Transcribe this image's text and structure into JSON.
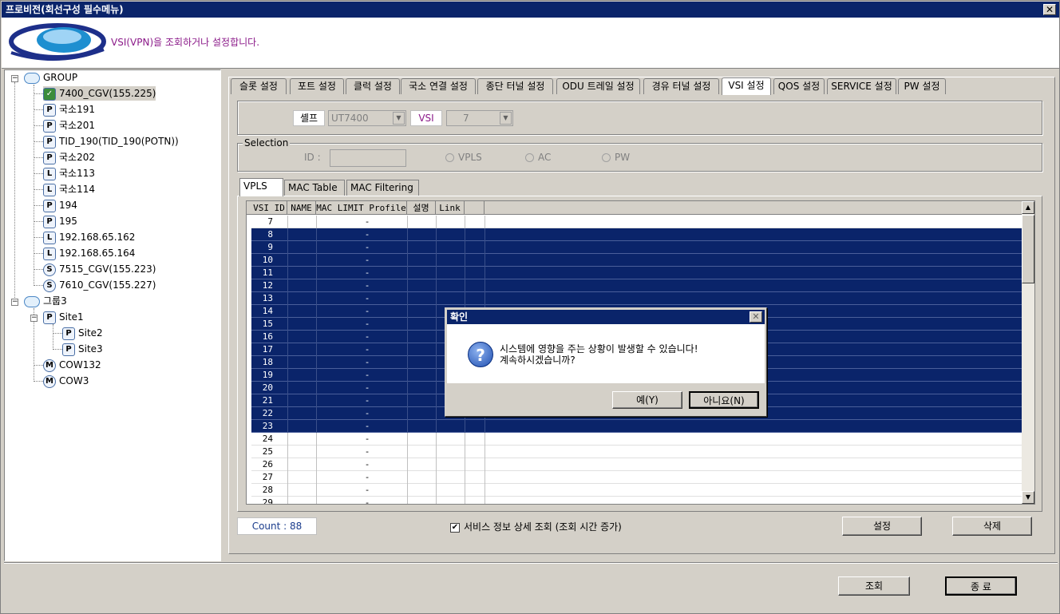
{
  "window": {
    "title": "프로비전(회선구성 필수메뉴)"
  },
  "header": {
    "message": "VSI(VPN)을 조회하거나 설정합니다."
  },
  "tree": {
    "root": {
      "label": "GROUP",
      "icon": "cloud-icon"
    },
    "items": [
      {
        "label": "7400_CGV(155.225)",
        "badge": "✓",
        "icon": "checked-node-icon"
      },
      {
        "label": "국소191",
        "badge": "P",
        "icon": "p-node-icon"
      },
      {
        "label": "국소201",
        "badge": "P",
        "icon": "p-node-icon"
      },
      {
        "label": "TID_190(TID_190(POTN))",
        "badge": "P",
        "icon": "p-node-icon"
      },
      {
        "label": "국소202",
        "badge": "P",
        "icon": "p-node-icon"
      },
      {
        "label": "국소113",
        "badge": "L",
        "icon": "l-node-icon"
      },
      {
        "label": "국소114",
        "badge": "L",
        "icon": "l-node-icon"
      },
      {
        "label": "194",
        "badge": "P",
        "icon": "p-node-icon"
      },
      {
        "label": "195",
        "badge": "P",
        "icon": "p-node-icon"
      },
      {
        "label": "192.168.65.162",
        "badge": "L",
        "icon": "l-node-icon"
      },
      {
        "label": "192.168.65.164",
        "badge": "L",
        "icon": "l-node-icon"
      },
      {
        "label": "7515_CGV(155.223)",
        "badge": "S",
        "icon": "s-node-icon"
      },
      {
        "label": "7610_CGV(155.227)",
        "badge": "S",
        "icon": "s-node-icon"
      }
    ],
    "group2": {
      "label": "그룹3",
      "icon": "cloud-icon"
    },
    "group2_items": [
      {
        "label": "Site1",
        "badge": "P"
      },
      {
        "label": "Site2",
        "badge": "P"
      },
      {
        "label": "Site3",
        "badge": "P"
      },
      {
        "label": "COW132",
        "badge": "M"
      },
      {
        "label": "COW3",
        "badge": "M"
      }
    ]
  },
  "tabs": [
    "슬롯 설정",
    "포트 설정",
    "클럭 설정",
    "국소 연결 설정",
    "종단 터널 설정",
    "ODU 트레일 설정",
    "경유 터널 설정",
    "VSI 설정",
    "QOS 설정",
    "SERVICE 설정",
    "PW 설정"
  ],
  "active_tab": "VSI 설정",
  "filter": {
    "shelf_label": "셸프",
    "shelf_value": "UT7400",
    "vsi_label": "VSI",
    "vsi_value": "7"
  },
  "selection": {
    "title": "Selection",
    "id_label": "ID :",
    "radio_vpls": "VPLS",
    "radio_ac": "AC",
    "radio_pw": "PW"
  },
  "subtabs": [
    "VPLS",
    "MAC Table",
    "MAC Filtering"
  ],
  "grid": {
    "headers": [
      "VSI ID",
      "NAME",
      "MAC LIMIT Profile",
      "설명",
      "Link"
    ],
    "rows": [
      {
        "id": "7",
        "mac": "-",
        "sel": false
      },
      {
        "id": "8",
        "mac": "-",
        "sel": true
      },
      {
        "id": "9",
        "mac": "-",
        "sel": true
      },
      {
        "id": "10",
        "mac": "-",
        "sel": true
      },
      {
        "id": "11",
        "mac": "-",
        "sel": true
      },
      {
        "id": "12",
        "mac": "-",
        "sel": true
      },
      {
        "id": "13",
        "mac": "-",
        "sel": true
      },
      {
        "id": "14",
        "mac": "-",
        "sel": true
      },
      {
        "id": "15",
        "mac": "-",
        "sel": true
      },
      {
        "id": "16",
        "mac": "-",
        "sel": true
      },
      {
        "id": "17",
        "mac": "-",
        "sel": true
      },
      {
        "id": "18",
        "mac": "-",
        "sel": true
      },
      {
        "id": "19",
        "mac": "-",
        "sel": true
      },
      {
        "id": "20",
        "mac": "-",
        "sel": true
      },
      {
        "id": "21",
        "mac": "-",
        "sel": true
      },
      {
        "id": "22",
        "mac": "-",
        "sel": true
      },
      {
        "id": "23",
        "mac": "-",
        "sel": true
      },
      {
        "id": "24",
        "mac": "-",
        "sel": false
      },
      {
        "id": "25",
        "mac": "-",
        "sel": false
      },
      {
        "id": "26",
        "mac": "-",
        "sel": false
      },
      {
        "id": "27",
        "mac": "-",
        "sel": false
      },
      {
        "id": "28",
        "mac": "-",
        "sel": false
      },
      {
        "id": "29",
        "mac": "-",
        "sel": false
      }
    ]
  },
  "count": "Count : 88",
  "detail_checkbox": {
    "label": "서비스 정보 상세 조회 (조회 시간 증가)",
    "checked": true
  },
  "buttons": {
    "set": "설정",
    "delete": "삭제",
    "query": "조회",
    "exit": "종 료"
  },
  "dialog": {
    "title": "확인",
    "line1": "시스템에 영향을 주는 상황이 발생할 수 있습니다!",
    "line2": "계속하시겠습니까?",
    "yes": "예(Y)",
    "no": "아니요(N)"
  },
  "colors": {
    "titlebar": "#0a246a",
    "selection": "#0a246a",
    "header_text": "#8b1a89"
  }
}
